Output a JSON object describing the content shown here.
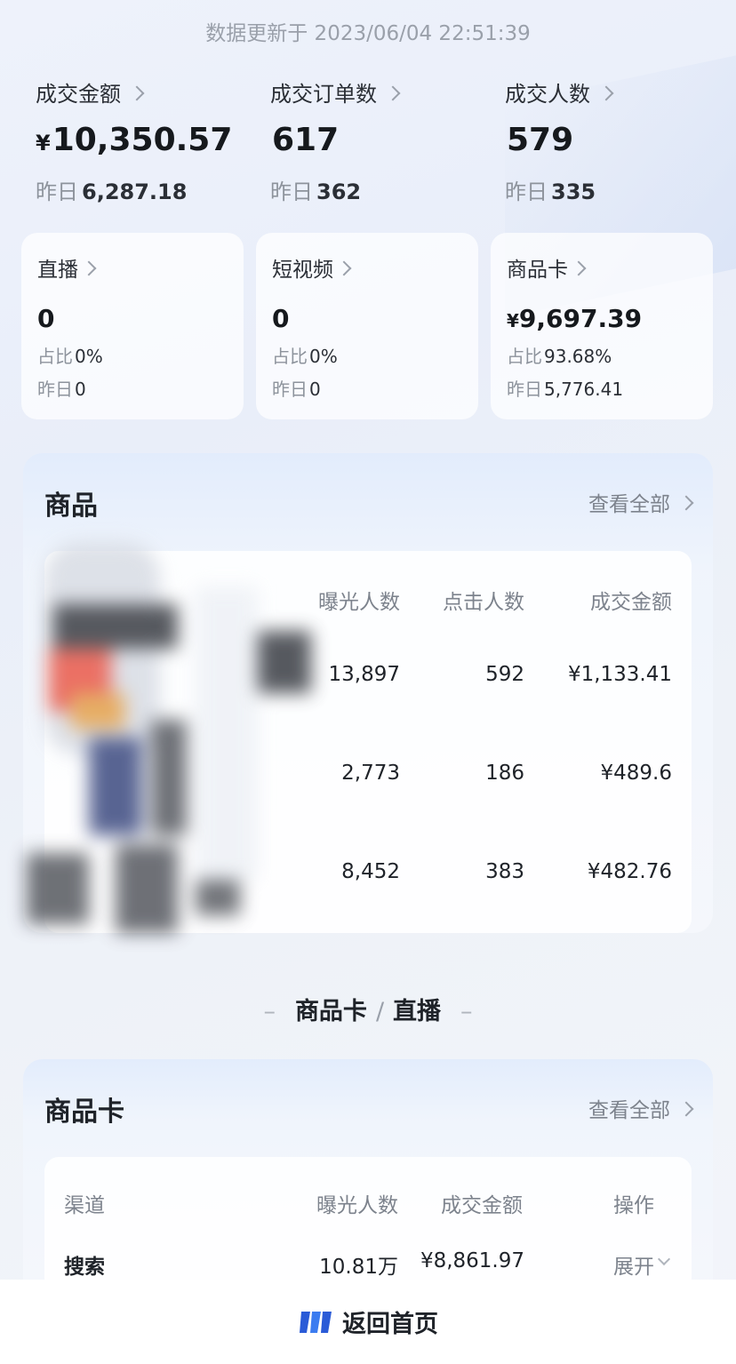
{
  "update_time": "数据更新于 2023/06/04 22:51:39",
  "metrics": [
    {
      "label": "成交金额",
      "currency": "¥",
      "value": "10,350.57",
      "yesterday_label": "昨日",
      "yesterday": "6,287.18"
    },
    {
      "label": "成交订单数",
      "currency": "",
      "value": "617",
      "yesterday_label": "昨日",
      "yesterday": "362"
    },
    {
      "label": "成交人数",
      "currency": "",
      "value": "579",
      "yesterday_label": "昨日",
      "yesterday": "335"
    }
  ],
  "channels": [
    {
      "label": "直播",
      "currency": "",
      "value": "0",
      "share_label": "占比",
      "share": "0%",
      "yesterday_label": "昨日",
      "yesterday": "0"
    },
    {
      "label": "短视频",
      "currency": "",
      "value": "0",
      "share_label": "占比",
      "share": "0%",
      "yesterday_label": "昨日",
      "yesterday": "0"
    },
    {
      "label": "商品卡",
      "currency": "¥",
      "value": "9,697.39",
      "share_label": "占比",
      "share": "93.68%",
      "yesterday_label": "昨日",
      "yesterday": "5,776.41"
    }
  ],
  "products": {
    "title": "商品",
    "view_all": "查看全部",
    "headers": [
      "曝光人数",
      "点击人数",
      "成交金额"
    ],
    "rows": [
      [
        "13,897",
        "592",
        "¥1,133.41"
      ],
      [
        "2,773",
        "186",
        "¥489.6"
      ],
      [
        "8,452",
        "383",
        "¥482.76"
      ]
    ]
  },
  "divider": {
    "left": "商品卡",
    "right": "直播",
    "sep": "/",
    "dash": "–"
  },
  "product_card": {
    "title": "商品卡",
    "view_all": "查看全部",
    "headers": [
      "渠道",
      "曝光人数",
      "成交金额",
      "操作"
    ],
    "rows": [
      {
        "channel": "搜索",
        "exposure": "10.81万",
        "amount": "¥8,861.97",
        "action": "展开"
      }
    ]
  },
  "bottom": {
    "label": "返回首页",
    "logo_icon": "app-logo-icon"
  }
}
